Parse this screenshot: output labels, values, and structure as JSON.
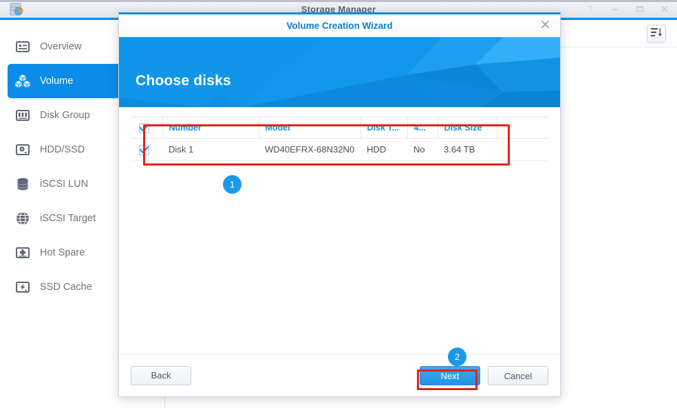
{
  "background_window": {
    "title": "Storage Manager",
    "logo_icon": "storage-manager-logo-icon",
    "controls": [
      {
        "name": "help-button",
        "icon": "question-mark-icon",
        "label": "?"
      },
      {
        "name": "minimize-button",
        "icon": "minimize-icon",
        "label": "–"
      },
      {
        "name": "maximize-button",
        "icon": "maximize-icon",
        "label": "□"
      },
      {
        "name": "close-button",
        "icon": "close-icon",
        "label": "✕"
      }
    ],
    "toolbar": {
      "sort_button": {
        "name": "sort-button",
        "icon": "sort-descending-icon"
      }
    }
  },
  "sidebar": {
    "items": [
      {
        "label": "Overview",
        "icon": "overview-card-icon",
        "active": false
      },
      {
        "label": "Volume",
        "icon": "volume-cubes-icon",
        "active": true
      },
      {
        "label": "Disk Group",
        "icon": "disk-group-icon",
        "active": false
      },
      {
        "label": "HDD/SSD",
        "icon": "hdd-ssd-icon",
        "active": false
      },
      {
        "label": "iSCSI LUN",
        "icon": "database-stack-icon",
        "active": false
      },
      {
        "label": "iSCSI Target",
        "icon": "globe-icon",
        "active": false
      },
      {
        "label": "Hot Spare",
        "icon": "hot-spare-plus-icon",
        "active": false
      },
      {
        "label": "SSD Cache",
        "icon": "ssd-cache-bolt-icon",
        "active": false
      }
    ]
  },
  "dialog": {
    "title": "Volume Creation Wizard",
    "close_icon": "close-icon",
    "banner_title": "Choose disks",
    "table": {
      "select_all_checked": true,
      "columns": [
        {
          "key": "check",
          "label": ""
        },
        {
          "key": "number",
          "label": "Number"
        },
        {
          "key": "model",
          "label": "Model"
        },
        {
          "key": "type",
          "label": "Disk T..."
        },
        {
          "key": "sector",
          "label": "4..."
        },
        {
          "key": "size",
          "label": "Disk Size"
        },
        {
          "key": "pad",
          "label": ""
        }
      ],
      "rows": [
        {
          "checked": true,
          "number": "Disk 1",
          "model": "WD40EFRX-68N32N0",
          "type": "HDD",
          "sector": "No",
          "size": "3.64 TB"
        }
      ]
    },
    "footer": {
      "back_label": "Back",
      "next_label": "Next",
      "cancel_label": "Cancel"
    }
  },
  "annotations": {
    "badges": [
      {
        "number": "1",
        "target": "disk-table"
      },
      {
        "number": "2",
        "target": "next-button"
      }
    ],
    "highlight_color": "#e8201a",
    "badge_color": "#1a9ae8"
  }
}
